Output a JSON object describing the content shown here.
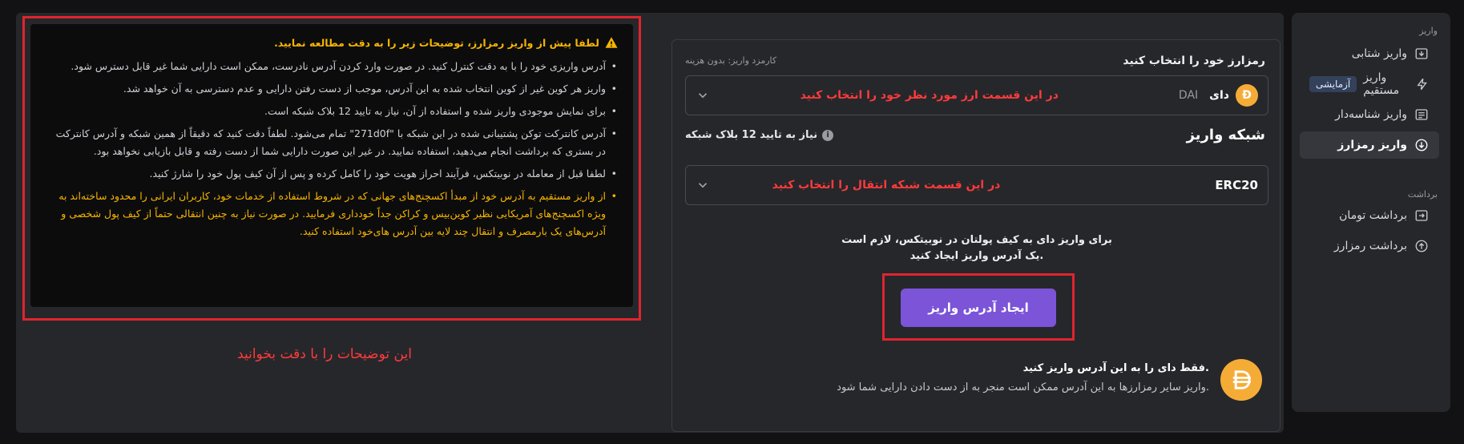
{
  "sidebar": {
    "deposit_section": "واریز",
    "withdraw_section": "برداشت",
    "items": [
      {
        "label": "واریز شتابی",
        "icon": "download-box-icon"
      },
      {
        "label": "واریز مستقیم",
        "icon": "lightning-icon",
        "badge": "آزمایشی"
      },
      {
        "label": "واریز شناسه‌دار",
        "icon": "bank-icon"
      },
      {
        "label": "واریز رمزارز",
        "icon": "arrow-down-circle-icon",
        "active": true
      },
      {
        "label": "برداشت تومان",
        "icon": "upload-box-icon"
      },
      {
        "label": "برداشت رمزارز",
        "icon": "arrow-up-circle-icon"
      }
    ]
  },
  "deposit": {
    "select_label": "رمزارز خود را انتخاب کنید",
    "fee_label": "کارمزد واریز: بدون هزینه",
    "coin": {
      "name": "دای",
      "symbol": "DAI"
    },
    "coin_hint": "در این قسمت ارز مورد نظر خود را انتخاب کنید",
    "network_title": "شبکه واریز",
    "confirm_note": "نیاز به تایید 12 بلاک شبکه",
    "network": "ERC20",
    "network_hint": "در این قسمت شبکه انتقال را انتخاب کنید",
    "address_line1": "برای واریز دای به کیف پولتان در نوبیتکس، لازم است",
    "address_line2": "یک آدرس واریز ایجاد کنید.",
    "create_button": "ایجاد آدرس واریز",
    "only_title": "فقط دای را به این آدرس واریز کنید.",
    "only_desc": "واریز سایر رمزارزها به این آدرس ممکن است منجر به از دست دادن دارایی شما شود."
  },
  "warning": {
    "title": "لطفا پیش از واریز رمزارز، توضیحات زیر را به دقت مطالعه نمایید.",
    "items": [
      {
        "text": "آدرس واریزی خود را با به دقت کنترل کنید. در صورت وارد کردن آدرس نادرست، ممکن است دارایی شما غیر قابل دسترس شود.",
        "orange": false
      },
      {
        "text": "واریز هر کوین غیر از کوین انتخاب شده به این آدرس، موجب از دست رفتن دارایی و عدم دسترسی به آن خواهد شد.",
        "orange": false
      },
      {
        "text": "برای نمایش موجودی واریز شده و استفاده از آن، نیاز به تایید 12 بلاک شبکه است.",
        "orange": false
      },
      {
        "text": "آدرس کانترکت توکن پشتیبانی شده در این شبکه با \"271d0f\" تمام می‌شود. لطفاً دقت کنید که دقیقاً از همین شبکه و آدرس کانترکت در بستری که برداشت انجام می‌دهید، استفاده نمایید. در غیر این صورت دارایی شما از دست رفته و قابل بازیابی نخواهد بود.",
        "orange": false
      },
      {
        "text": "لطفا قبل از معامله در نوبیتکس، فرآیند احراز هویت خود را کامل کرده و پس از آن کیف پول خود را شارژ کنید.",
        "orange": false
      },
      {
        "text": "از واریز مستقیم به آدرس خود از مبدأ اکسچنج‌های جهانی که در شروط استفاده از خدمات خود، کاربران ایرانی را محدود ساخته‌اند به ویژه اکسچنج‌های آمریکایی نظیر کوین‌بیس و کراکن جداً خودداری فرمایید. در صورت نیاز به چنین انتقالی حتماً از کیف پول شخصی و آدرس‌های یک بارمصرف و انتقال چند لایه بین آدرس های‌خود استفاده کنید.",
        "orange": true
      }
    ]
  },
  "read_hint": "این توضیحات را با دقت بخوانید",
  "colors": {
    "accent": "#7b54d8",
    "warning": "#f7b500",
    "annotation_red": "#e0242e",
    "dai": "#f5ac37"
  }
}
